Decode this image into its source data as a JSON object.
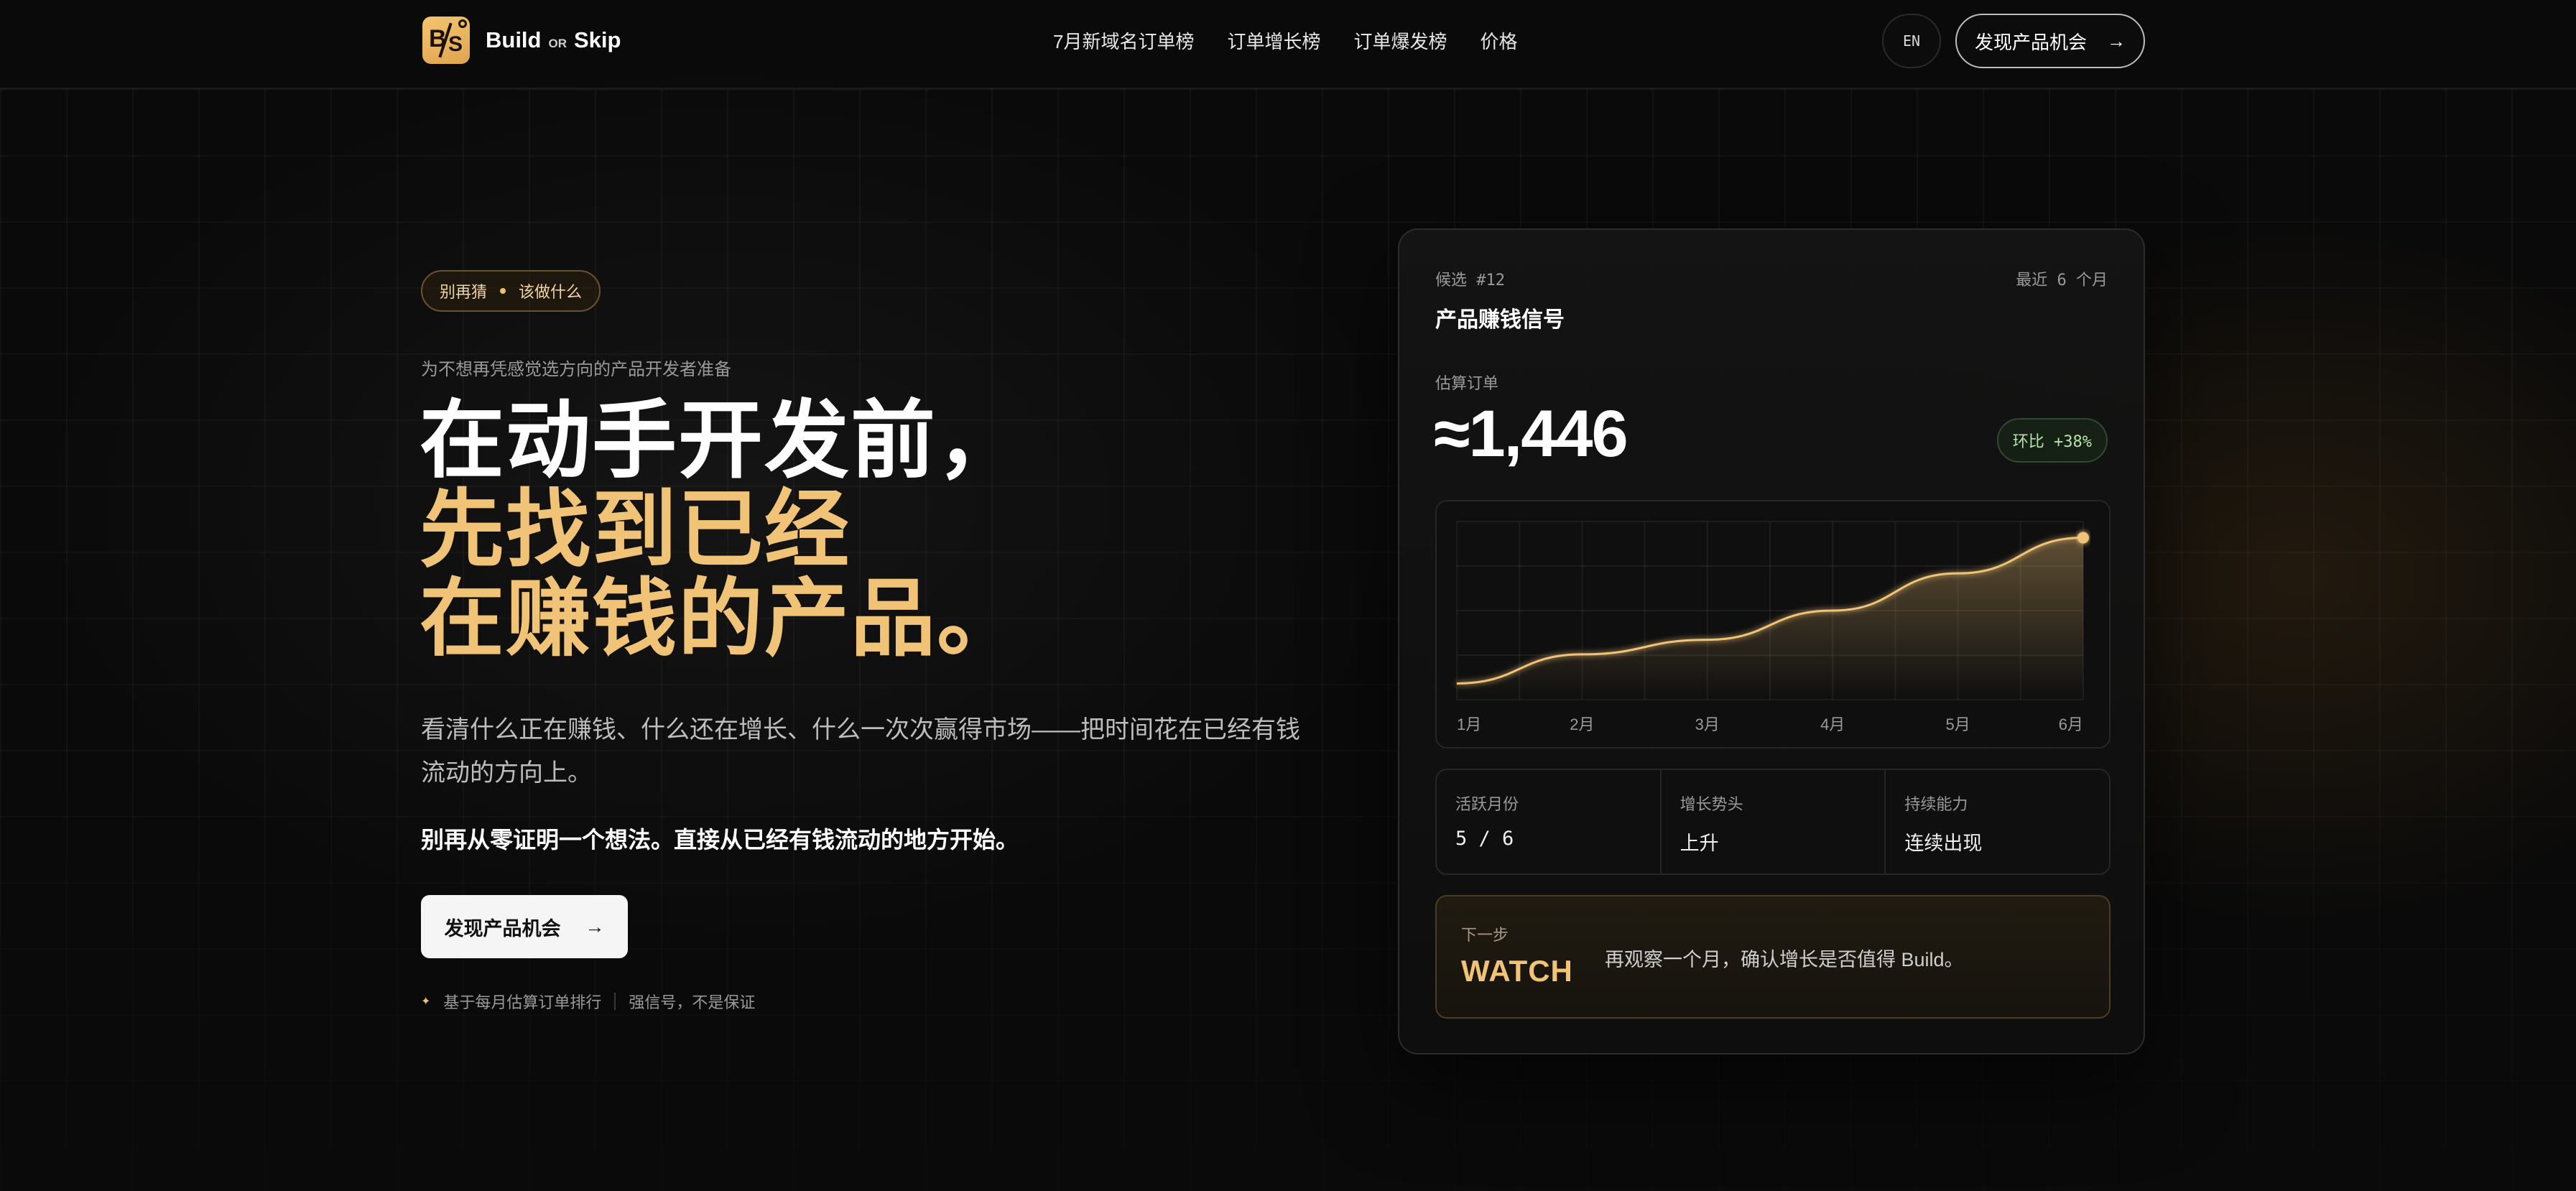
{
  "nav": {
    "brand": {
      "logo_letters": "B/S",
      "word1": "Build",
      "or": "OR",
      "word2": "Skip"
    },
    "menu": [
      "7月新域名订单榜",
      "订单增长榜",
      "订单爆发榜",
      "价格"
    ],
    "lang_button": "EN",
    "cta_label": "发现产品机会",
    "cta_icon": "arrow-right-icon"
  },
  "hero": {
    "tag_left": "别再猜",
    "tag_right": "该做什么",
    "eyebrow": "为不想再凭感觉选方向的产品开发者准备",
    "headline": [
      "在动手开发前，",
      "先找到已经",
      "在赚钱的产品。"
    ],
    "lead": "看清什么正在赚钱、什么还在增长、什么一次次赢得市场——把时间花在已经有钱流动的方向上。",
    "strong": "别再从零证明一个想法。直接从已经有钱流动的地方开始。",
    "cta_label": "发现产品机会",
    "foot_left": "基于每月估算订单排行",
    "foot_right": "强信号，不是保证"
  },
  "card": {
    "candidate": "候选 #12",
    "recent": "最近 6 个月",
    "title": "产品赚钱信号",
    "est_label": "估算订单",
    "est_value": "≈1,446",
    "badge": "环比 +38%",
    "stats": [
      {
        "label": "活跃月份",
        "value": "5 / 6"
      },
      {
        "label": "增长势头",
        "value": "上升"
      },
      {
        "label": "持续能力",
        "value": "连续出现"
      }
    ],
    "next_label": "下一步",
    "next_word": "WATCH",
    "next_desc": "再观察一个月，确认增长是否值得 Build。"
  },
  "chart_data": {
    "type": "area",
    "categories": [
      "1月",
      "2月",
      "3月",
      "4月",
      "5月",
      "6月"
    ],
    "series": [
      {
        "values": [
          0.1,
          0.28,
          0.37,
          0.55,
          0.78,
          1.0
        ]
      }
    ],
    "ylim": [
      0,
      1.1
    ],
    "grid": true,
    "accent": "#f1c376"
  },
  "colors": {
    "background": "#0a0a0a",
    "accent": "#f1c376",
    "badge_green": "#b6e3a8"
  }
}
